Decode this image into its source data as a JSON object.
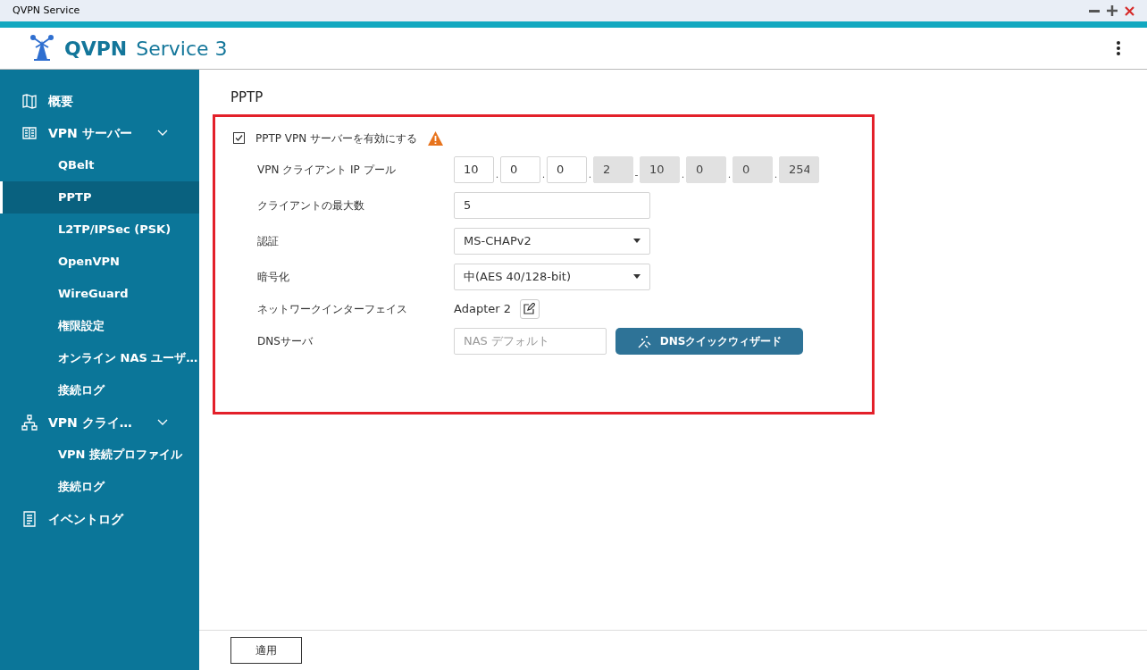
{
  "window": {
    "title": "QVPN Service"
  },
  "header": {
    "logo_bold": "QVPN",
    "logo_light": "Service 3"
  },
  "sidebar": {
    "items": [
      {
        "label": "概要",
        "selected": false
      },
      {
        "label": "VPN サーバー",
        "selected": false,
        "expanded": true,
        "children": [
          {
            "label": "QBelt",
            "selected": false
          },
          {
            "label": "PPTP",
            "selected": true
          },
          {
            "label": "L2TP/IPSec (PSK)",
            "selected": false
          },
          {
            "label": "OpenVPN",
            "selected": false
          },
          {
            "label": "WireGuard",
            "selected": false
          },
          {
            "label": "権限設定",
            "selected": false
          },
          {
            "label": "オンライン NAS ユーザ…",
            "selected": false
          },
          {
            "label": "接続ログ",
            "selected": false
          }
        ]
      },
      {
        "label": "VPN クライ…",
        "selected": false,
        "expanded": true,
        "children": [
          {
            "label": "VPN 接続プロファイル",
            "selected": false
          },
          {
            "label": "接続ログ",
            "selected": false
          }
        ]
      },
      {
        "label": "イベントログ",
        "selected": false
      }
    ]
  },
  "page": {
    "title": "PPTP",
    "enable": {
      "label": "PPTP VPN サーバーを有効にする",
      "checked": true
    },
    "ip_pool": {
      "label": "VPN クライアント IP プール",
      "octets": [
        {
          "value": "10",
          "disabled": false
        },
        {
          "separator": ".",
          "value": "0",
          "disabled": false
        },
        {
          "separator": ".",
          "value": "0",
          "disabled": false
        },
        {
          "separator": ".",
          "value": "2",
          "disabled": true
        },
        {
          "separator": "-",
          "value": "10",
          "disabled": true
        },
        {
          "separator": ".",
          "value": "0",
          "disabled": true
        },
        {
          "separator": ".",
          "value": "0",
          "disabled": true
        },
        {
          "separator": ".",
          "value": "254",
          "disabled": true
        }
      ]
    },
    "max_clients": {
      "label": "クライアントの最大数",
      "value": "5"
    },
    "auth": {
      "label": "認証",
      "value": "MS-CHAPv2"
    },
    "encryption": {
      "label": "暗号化",
      "value": "中(AES 40/128-bit)"
    },
    "interface": {
      "label": "ネットワークインターフェイス",
      "value": "Adapter 2"
    },
    "dns": {
      "label": "DNSサーバ",
      "placeholder": "NAS デフォルト",
      "button": "DNSクイックウィザード"
    }
  },
  "footer": {
    "apply": "適用"
  }
}
